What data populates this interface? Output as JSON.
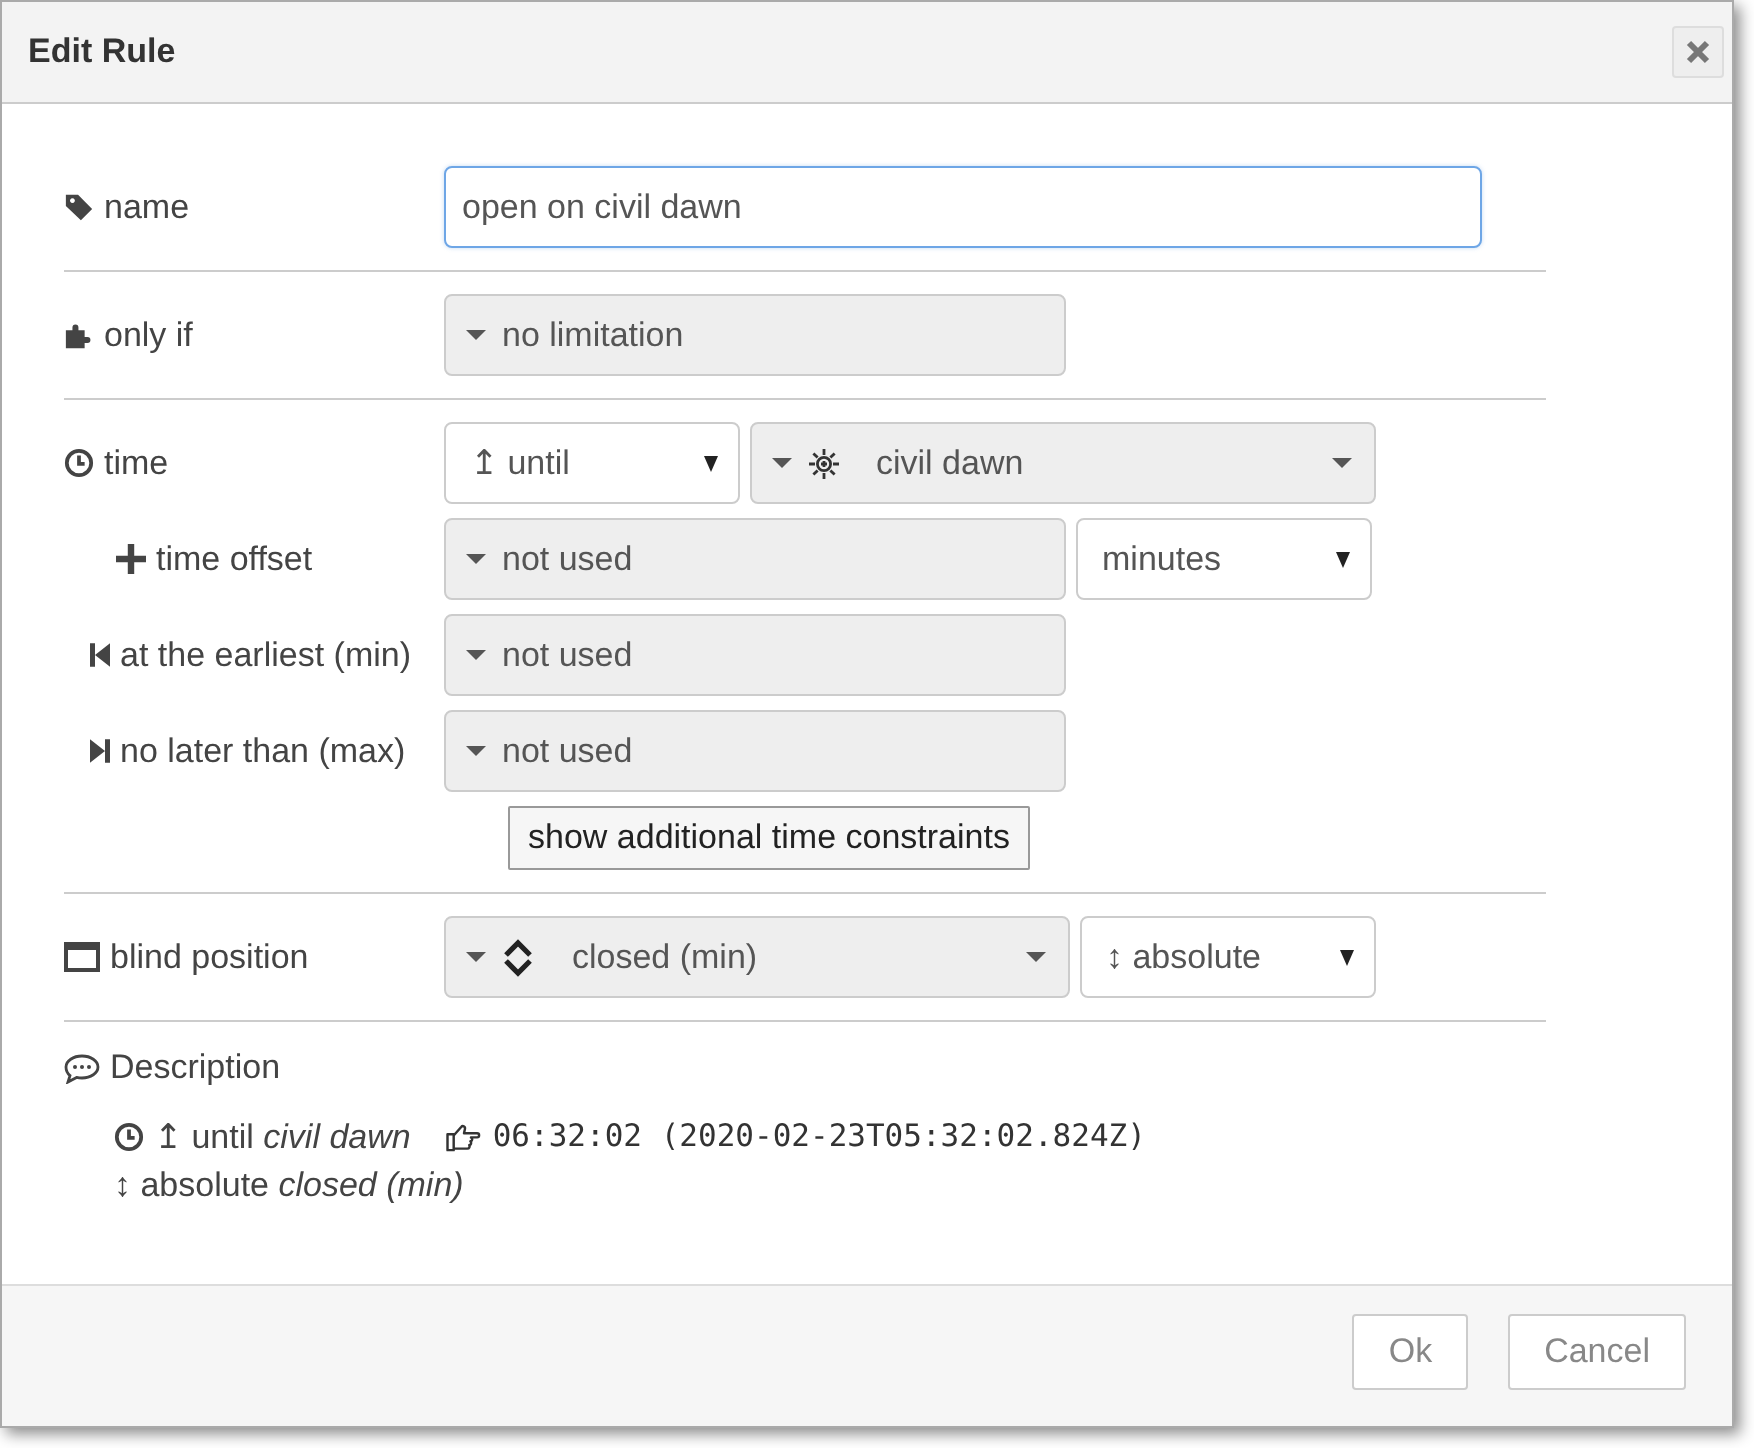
{
  "dialog": {
    "title": "Edit Rule"
  },
  "sections": [
    {
      "rows": [
        {
          "label": "name",
          "controls": [
            {
              "kind": "text",
              "value": "open on civil dawn",
              "focused": true
            }
          ]
        }
      ]
    },
    {
      "rows": [
        {
          "label": "only if",
          "controls": [
            {
              "kind": "type",
              "value": "no limitation"
            }
          ]
        }
      ]
    },
    {
      "rows": [
        {
          "label": "time",
          "controls": [
            {
              "kind": "select",
              "value": "↥ until"
            },
            {
              "kind": "type-option",
              "value": "civil dawn"
            }
          ]
        },
        {
          "label": "time offset",
          "controls": [
            {
              "kind": "type",
              "value": "not used"
            },
            {
              "kind": "select",
              "value": "minutes"
            }
          ]
        },
        {
          "label": "at the earliest (min)",
          "controls": [
            {
              "kind": "type",
              "value": "not used"
            }
          ]
        },
        {
          "label": "no later than (max)",
          "controls": [
            {
              "kind": "type",
              "value": "not used"
            }
          ]
        }
      ],
      "button": "show additional time constraints"
    },
    {
      "rows": [
        {
          "label": "blind position",
          "controls": [
            {
              "kind": "type-option",
              "value": "closed (min)"
            },
            {
              "kind": "select",
              "value": "↕ absolute"
            }
          ]
        }
      ]
    }
  ],
  "description": {
    "title": "Description",
    "lines": [
      {
        "kind": "time",
        "text": "↥ until *civil dawn*",
        "time": "06:32:02 (2020-02-23T05:32:02.824Z)"
      },
      {
        "kind": "position",
        "text": "↕ absolute *closed (min)*"
      }
    ]
  },
  "buttons": [
    "Ok",
    "Cancel"
  ]
}
